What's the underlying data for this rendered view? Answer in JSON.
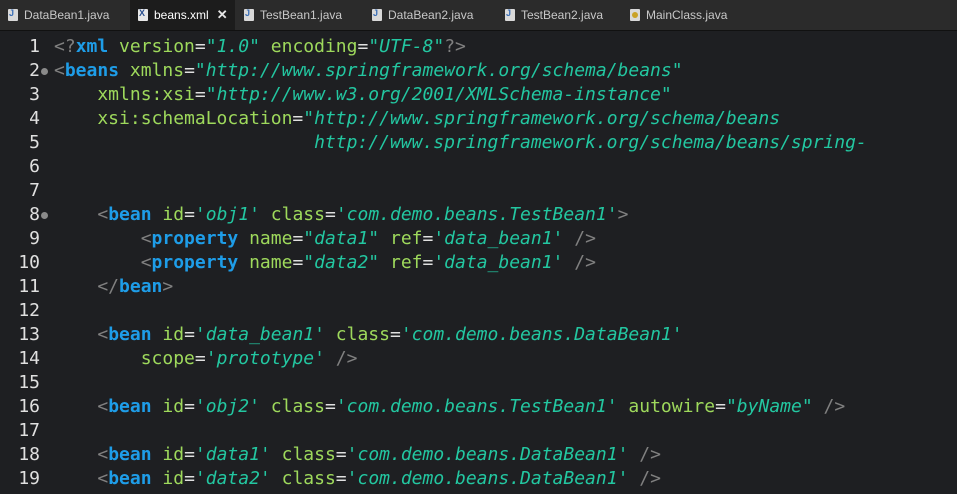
{
  "tabs": [
    {
      "label": "DataBean1.java",
      "icon": "java-file-icon"
    },
    {
      "label": "beans.xml",
      "icon": "xml-file-icon",
      "active": true,
      "close": "✕"
    },
    {
      "label": "TestBean1.java",
      "icon": "java-file-icon"
    },
    {
      "label": "DataBean2.java",
      "icon": "java-file-icon"
    },
    {
      "label": "TestBean2.java",
      "icon": "java-file-icon"
    },
    {
      "label": "MainClass.java",
      "icon": "main-class-file-icon"
    }
  ],
  "lines": [
    {
      "n": "1",
      "fold": false,
      "tokens": [
        {
          "t": "<?",
          "c": "pun"
        },
        {
          "t": "xml",
          "c": "tag"
        },
        {
          "t": " version",
          "c": "attr"
        },
        {
          "t": "=",
          "c": "eq"
        },
        {
          "t": "\"1.0\"",
          "c": "val"
        },
        {
          "t": " encoding",
          "c": "attr"
        },
        {
          "t": "=",
          "c": "eq"
        },
        {
          "t": "\"UTF-8\"",
          "c": "val"
        },
        {
          "t": "?>",
          "c": "pun"
        }
      ]
    },
    {
      "n": "2",
      "fold": true,
      "tokens": [
        {
          "t": "<",
          "c": "pun"
        },
        {
          "t": "beans",
          "c": "tag"
        },
        {
          "t": " xmlns",
          "c": "attr"
        },
        {
          "t": "=",
          "c": "eq"
        },
        {
          "t": "\"http://www.springframework.org/schema/beans\"",
          "c": "val"
        }
      ]
    },
    {
      "n": "3",
      "fold": false,
      "tokens": [
        {
          "t": "    xmlns:xsi",
          "c": "attr"
        },
        {
          "t": "=",
          "c": "eq"
        },
        {
          "t": "\"http://www.w3.org/2001/XMLSchema-instance\"",
          "c": "val"
        }
      ]
    },
    {
      "n": "4",
      "fold": false,
      "tokens": [
        {
          "t": "    xsi:schemaLocation",
          "c": "attr"
        },
        {
          "t": "=",
          "c": "eq"
        },
        {
          "t": "\"http://www.springframework.org/schema/beans",
          "c": "val"
        }
      ]
    },
    {
      "n": "5",
      "fold": false,
      "tokens": [
        {
          "t": "                        http://www.springframework.org/schema/beans/spring-",
          "c": "val"
        }
      ]
    },
    {
      "n": "6",
      "fold": false,
      "tokens": []
    },
    {
      "n": "7",
      "fold": false,
      "tokens": []
    },
    {
      "n": "8",
      "fold": true,
      "tokens": [
        {
          "t": "    <",
          "c": "pun"
        },
        {
          "t": "bean",
          "c": "tag"
        },
        {
          "t": " id",
          "c": "attr"
        },
        {
          "t": "=",
          "c": "eq"
        },
        {
          "t": "'obj1'",
          "c": "val"
        },
        {
          "t": " class",
          "c": "attr"
        },
        {
          "t": "=",
          "c": "eq"
        },
        {
          "t": "'com.demo.beans.TestBean1'",
          "c": "val"
        },
        {
          "t": ">",
          "c": "pun"
        }
      ]
    },
    {
      "n": "9",
      "fold": false,
      "tokens": [
        {
          "t": "        <",
          "c": "pun"
        },
        {
          "t": "property",
          "c": "tag"
        },
        {
          "t": " name",
          "c": "attr"
        },
        {
          "t": "=",
          "c": "eq"
        },
        {
          "t": "\"data1\"",
          "c": "val"
        },
        {
          "t": " ref",
          "c": "attr"
        },
        {
          "t": "=",
          "c": "eq"
        },
        {
          "t": "'data_bean1'",
          "c": "val"
        },
        {
          "t": " />",
          "c": "pun"
        }
      ]
    },
    {
      "n": "10",
      "fold": false,
      "tokens": [
        {
          "t": "        <",
          "c": "pun"
        },
        {
          "t": "property",
          "c": "tag"
        },
        {
          "t": " name",
          "c": "attr"
        },
        {
          "t": "=",
          "c": "eq"
        },
        {
          "t": "\"data2\"",
          "c": "val"
        },
        {
          "t": " ref",
          "c": "attr"
        },
        {
          "t": "=",
          "c": "eq"
        },
        {
          "t": "'data_bean1'",
          "c": "val"
        },
        {
          "t": " />",
          "c": "pun"
        }
      ]
    },
    {
      "n": "11",
      "fold": false,
      "tokens": [
        {
          "t": "    </",
          "c": "pun"
        },
        {
          "t": "bean",
          "c": "tag"
        },
        {
          "t": ">",
          "c": "pun"
        }
      ]
    },
    {
      "n": "12",
      "fold": false,
      "tokens": []
    },
    {
      "n": "13",
      "fold": false,
      "tokens": [
        {
          "t": "    <",
          "c": "pun"
        },
        {
          "t": "bean",
          "c": "tag"
        },
        {
          "t": " id",
          "c": "attr"
        },
        {
          "t": "=",
          "c": "eq"
        },
        {
          "t": "'data_bean1'",
          "c": "val"
        },
        {
          "t": " class",
          "c": "attr"
        },
        {
          "t": "=",
          "c": "eq"
        },
        {
          "t": "'com.demo.beans.DataBean1'",
          "c": "val"
        }
      ]
    },
    {
      "n": "14",
      "fold": false,
      "tokens": [
        {
          "t": "        scope",
          "c": "attr"
        },
        {
          "t": "=",
          "c": "eq"
        },
        {
          "t": "'prototype'",
          "c": "val"
        },
        {
          "t": " />",
          "c": "pun"
        }
      ]
    },
    {
      "n": "15",
      "fold": false,
      "tokens": []
    },
    {
      "n": "16",
      "fold": false,
      "tokens": [
        {
          "t": "    <",
          "c": "pun"
        },
        {
          "t": "bean",
          "c": "tag"
        },
        {
          "t": " id",
          "c": "attr"
        },
        {
          "t": "=",
          "c": "eq"
        },
        {
          "t": "'obj2'",
          "c": "val"
        },
        {
          "t": " class",
          "c": "attr"
        },
        {
          "t": "=",
          "c": "eq"
        },
        {
          "t": "'com.demo.beans.TestBean1'",
          "c": "val"
        },
        {
          "t": " autowire",
          "c": "attr"
        },
        {
          "t": "=",
          "c": "eq"
        },
        {
          "t": "\"byName\"",
          "c": "val"
        },
        {
          "t": " />",
          "c": "pun"
        }
      ]
    },
    {
      "n": "17",
      "fold": false,
      "tokens": []
    },
    {
      "n": "18",
      "fold": false,
      "tokens": [
        {
          "t": "    <",
          "c": "pun"
        },
        {
          "t": "bean",
          "c": "tag"
        },
        {
          "t": " id",
          "c": "attr"
        },
        {
          "t": "=",
          "c": "eq"
        },
        {
          "t": "'data1'",
          "c": "val"
        },
        {
          "t": " class",
          "c": "attr"
        },
        {
          "t": "=",
          "c": "eq"
        },
        {
          "t": "'com.demo.beans.DataBean1'",
          "c": "val"
        },
        {
          "t": " />",
          "c": "pun"
        }
      ]
    },
    {
      "n": "19",
      "fold": false,
      "tokens": [
        {
          "t": "    <",
          "c": "pun"
        },
        {
          "t": "bean",
          "c": "tag"
        },
        {
          "t": " id",
          "c": "attr"
        },
        {
          "t": "=",
          "c": "eq"
        },
        {
          "t": "'data2'",
          "c": "val"
        },
        {
          "t": " class",
          "c": "attr"
        },
        {
          "t": "=",
          "c": "eq"
        },
        {
          "t": "'com.demo.beans.DataBean1'",
          "c": "val"
        },
        {
          "t": " />",
          "c": "pun"
        }
      ]
    }
  ],
  "colors": {
    "tag": "#1e9de8",
    "attribute": "#9ed95c",
    "value": "#23c7a1",
    "punctuation": "#808080",
    "background": "#1e1f22"
  }
}
